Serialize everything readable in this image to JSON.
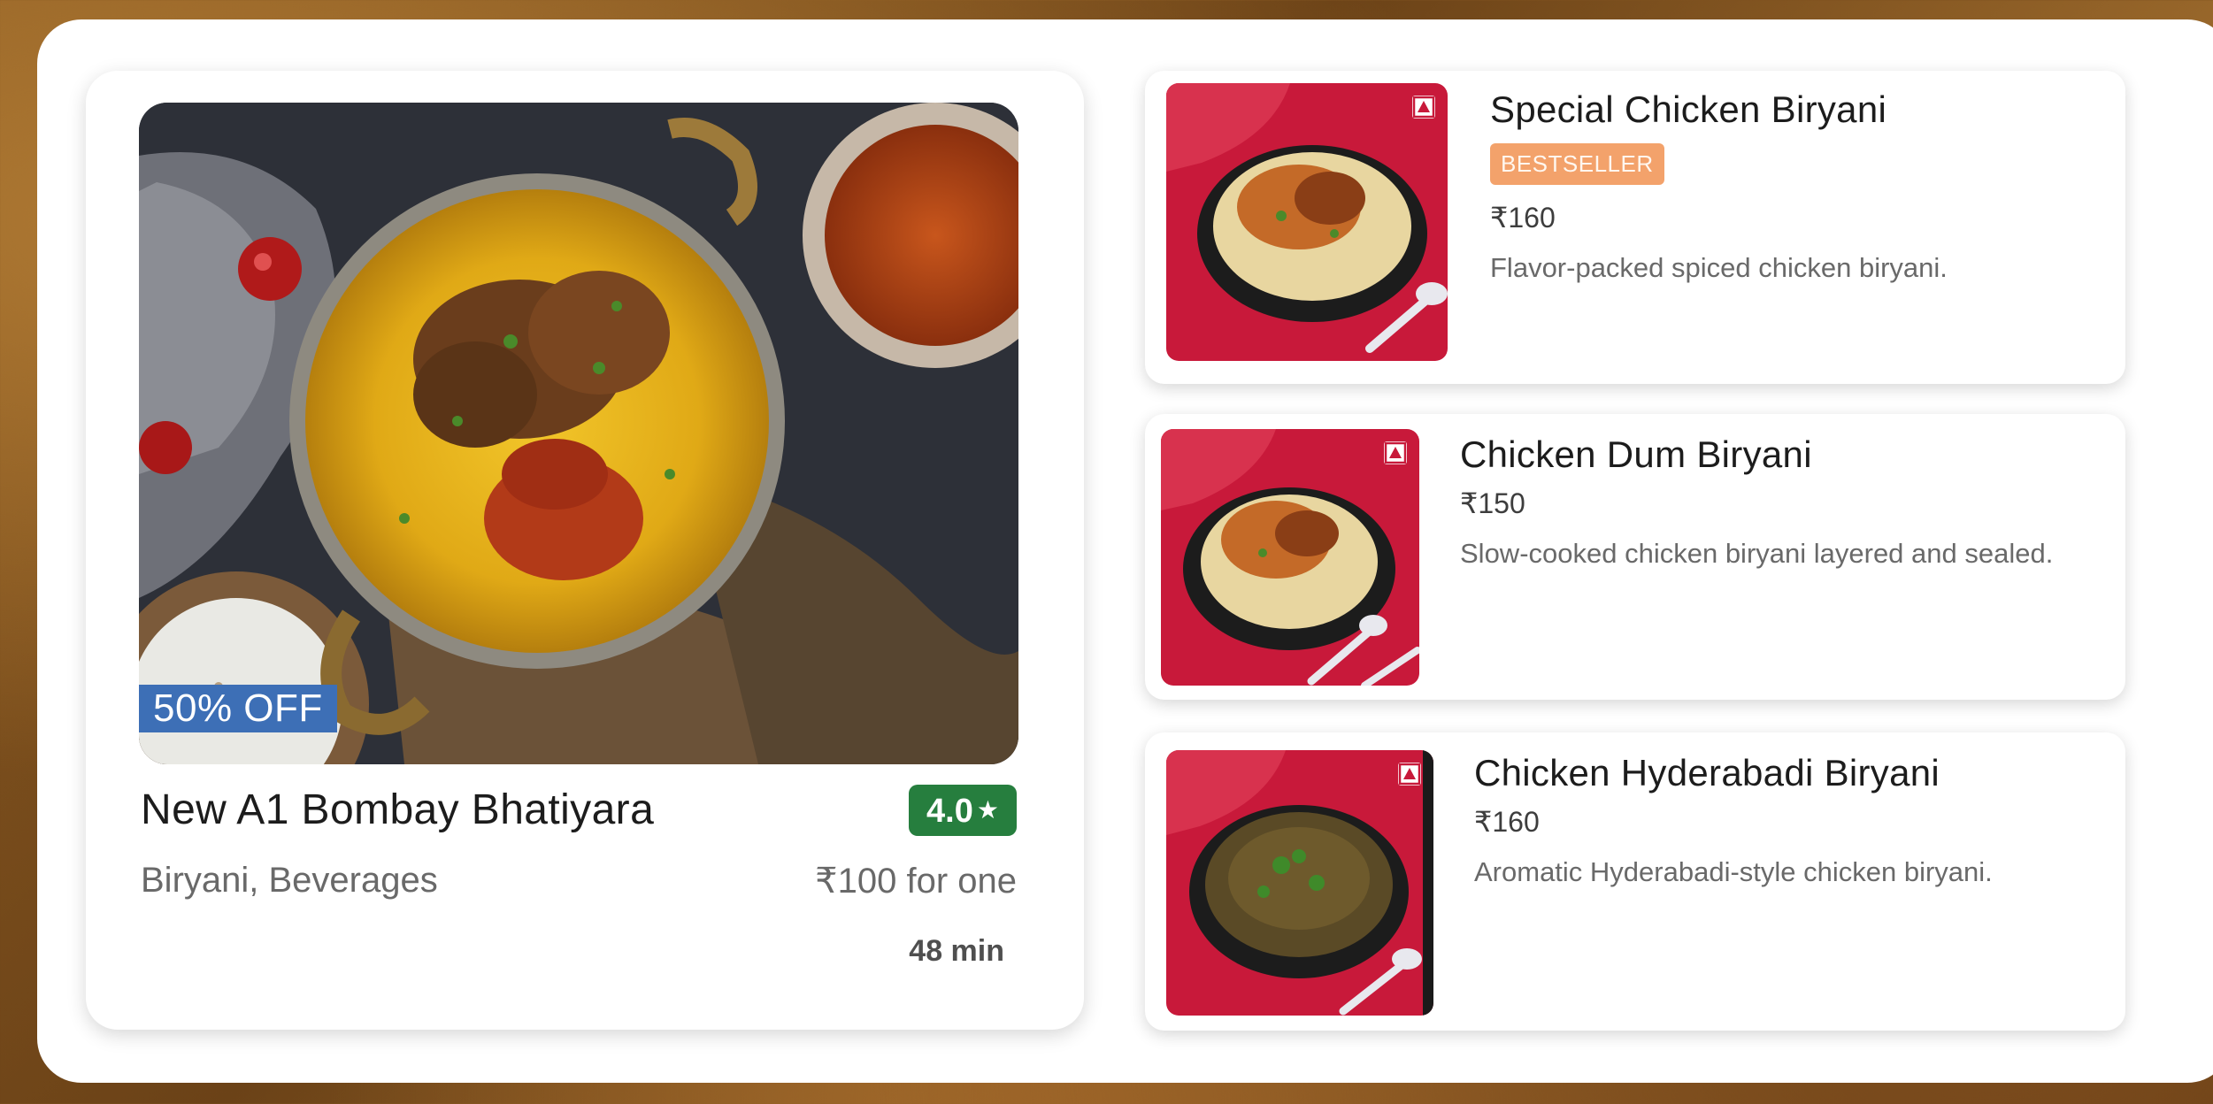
{
  "restaurant": {
    "name": "New A1 Bombay Bhatiyara",
    "offer": "50% OFF",
    "rating": "4.0",
    "cuisines": "Biryani, Beverages",
    "cost": "₹100 for one",
    "delivery_time": "48 min"
  },
  "dishes": [
    {
      "name": "Special Chicken Biryani",
      "badge": "BESTSELLER",
      "price": "₹160",
      "description": "Flavor-packed spiced chicken biryani."
    },
    {
      "name": "Chicken Dum Biryani",
      "price": "₹150",
      "description": "Slow-cooked chicken biryani layered and sealed."
    },
    {
      "name": "Chicken Hyderabadi Biryani",
      "price": "₹160",
      "description": "Aromatic Hyderabadi-style chicken biryani."
    }
  ],
  "colors": {
    "offer_badge": "#3d6fb6",
    "rating_green": "#267e3e",
    "bestseller": "#f3a26b",
    "dish_background_red": "#c8193a"
  },
  "icons": {
    "rating": "star-icon",
    "dish_marker": "non-veg-marker-icon"
  }
}
